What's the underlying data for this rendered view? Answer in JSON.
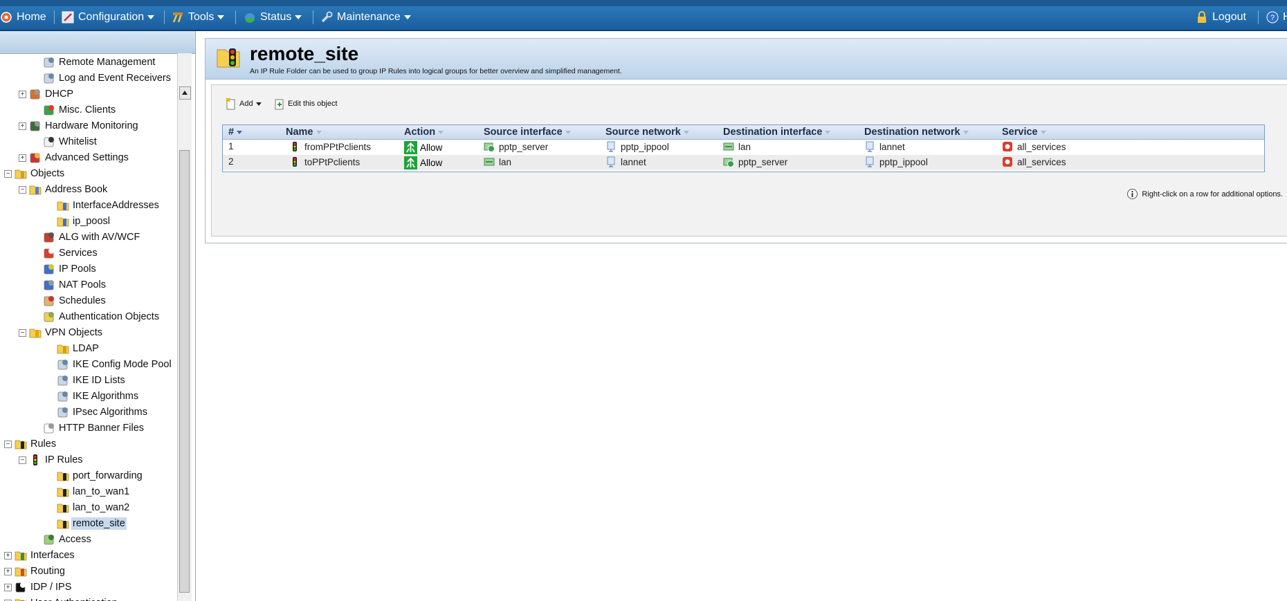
{
  "nav": {
    "items": [
      {
        "label": "Home",
        "icon": "home-icon"
      },
      {
        "label": "Configuration",
        "icon": "configuration-icon"
      },
      {
        "label": "Tools",
        "icon": "tools-icon"
      },
      {
        "label": "Status",
        "icon": "status-icon"
      },
      {
        "label": "Maintenance",
        "icon": "wrench-icon"
      }
    ],
    "logout": "Logout",
    "help_partial": "H"
  },
  "tree": [
    {
      "label": "Remote Management",
      "icon": "remote-management-icon"
    },
    {
      "label": "Log and Event Receivers",
      "icon": "log-receiver-icon"
    },
    {
      "label": "DHCP",
      "icon": "dhcp-icon"
    },
    {
      "label": "Misc. Clients",
      "icon": "misc-clients-icon"
    },
    {
      "label": "Hardware Monitoring",
      "icon": "hardware-monitoring-icon"
    },
    {
      "label": "Whitelist",
      "icon": "whitelist-icon"
    },
    {
      "label": "Advanced Settings",
      "icon": "advanced-settings-icon"
    },
    {
      "label": "Objects",
      "icon": "folder-icon"
    },
    {
      "label": "Address Book",
      "icon": "address-book-icon"
    },
    {
      "label": "InterfaceAddresses",
      "icon": "address-folder-icon"
    },
    {
      "label": "ip_poosl",
      "icon": "address-folder-icon"
    },
    {
      "label": "ALG with AV/WCF",
      "icon": "alg-icon"
    },
    {
      "label": "Services",
      "icon": "services-icon"
    },
    {
      "label": "IP Pools",
      "icon": "ip-pools-icon"
    },
    {
      "label": "NAT Pools",
      "icon": "nat-pools-icon"
    },
    {
      "label": "Schedules",
      "icon": "schedules-icon"
    },
    {
      "label": "Authentication Objects",
      "icon": "authentication-objects-icon"
    },
    {
      "label": "VPN Objects",
      "icon": "vpn-folder-icon"
    },
    {
      "label": "LDAP",
      "icon": "ldap-folder-icon"
    },
    {
      "label": "IKE Config Mode Pool",
      "icon": "ike-config-icon"
    },
    {
      "label": "IKE ID Lists",
      "icon": "ike-id-lists-icon"
    },
    {
      "label": "IKE Algorithms",
      "icon": "ike-algorithms-icon"
    },
    {
      "label": "IPsec Algorithms",
      "icon": "ipsec-algorithms-icon"
    },
    {
      "label": "HTTP Banner Files",
      "icon": "http-banner-icon"
    },
    {
      "label": "Rules",
      "icon": "rules-folder-icon"
    },
    {
      "label": "IP Rules",
      "icon": "traffic-light-icon"
    },
    {
      "label": "port_forwarding",
      "icon": "rule-folder-icon"
    },
    {
      "label": "lan_to_wan1",
      "icon": "rule-folder-icon"
    },
    {
      "label": "lan_to_wan2",
      "icon": "rule-folder-icon"
    },
    {
      "label": "remote_site",
      "icon": "rule-folder-icon"
    },
    {
      "label": "Access",
      "icon": "access-icon"
    },
    {
      "label": "Interfaces",
      "icon": "interfaces-folder-icon"
    },
    {
      "label": "Routing",
      "icon": "routing-folder-icon"
    },
    {
      "label": "IDP / IPS",
      "icon": "idp-icon"
    },
    {
      "label": "User Authentication",
      "icon": "user-auth-icon"
    }
  ],
  "page": {
    "title": "remote_site",
    "description": "An IP Rule Folder can be used to group IP Rules into logical groups for better overview and simplified management."
  },
  "toolbar": {
    "add_label": "Add",
    "edit_label": "Edit this object"
  },
  "grid": {
    "columns": [
      "#",
      "Name",
      "Action",
      "Source interface",
      "Source network",
      "Destination interface",
      "Destination network",
      "Service"
    ],
    "rows": [
      {
        "num": "1",
        "name": "fromPPtPclients",
        "action": "Allow",
        "src_if": "pptp_server",
        "src_net": "pptp_ippool",
        "dst_if": "lan",
        "dst_net": "lannet",
        "service": "all_services"
      },
      {
        "num": "2",
        "name": "toPPtPclients",
        "action": "Allow",
        "src_if": "lan",
        "src_net": "lannet",
        "dst_if": "pptp_server",
        "dst_net": "pptp_ippool",
        "service": "all_services"
      }
    ]
  },
  "hint": "Right-click on a row  for additional options.",
  "colors": {
    "nav_bg": "#1f66a8",
    "allow_green": "#1fa33b",
    "selected": "#c7daf0"
  }
}
